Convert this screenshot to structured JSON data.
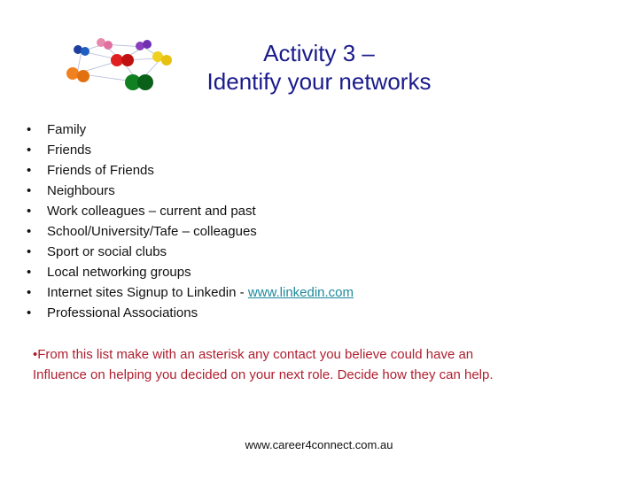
{
  "logo": {
    "icon": "people-network-icon",
    "colors": [
      "#1f3fa0",
      "#e88ab0",
      "#8a3fc0",
      "#f0d020",
      "#e02020",
      "#f08020",
      "#108020"
    ]
  },
  "title": {
    "line1": "Activity 3 –",
    "line2": "Identify your networks",
    "color": "#1a1a8c"
  },
  "bullets": [
    {
      "text": "Family"
    },
    {
      "text": "Friends"
    },
    {
      "text": "Friends of Friends"
    },
    {
      "text": "Neighbours"
    },
    {
      "text": "Work colleagues – current and past"
    },
    {
      "text": "School/University/Tafe – colleagues"
    },
    {
      "text": "Sport or social clubs"
    },
    {
      "text": "Local networking groups"
    },
    {
      "text": "Internet sites Signup to Linkedin - ",
      "link": "www.linkedin.com"
    },
    {
      "text": "Professional Associations"
    }
  ],
  "bullet_glyph": "•",
  "note": {
    "line1": "•From this list make with an asterisk any contact you believe could have an",
    "line2": "Influence on helping you decided on your next role.  Decide how they can help.",
    "color": "#b02030"
  },
  "footer": {
    "text": "www.career4connect.com.au"
  }
}
